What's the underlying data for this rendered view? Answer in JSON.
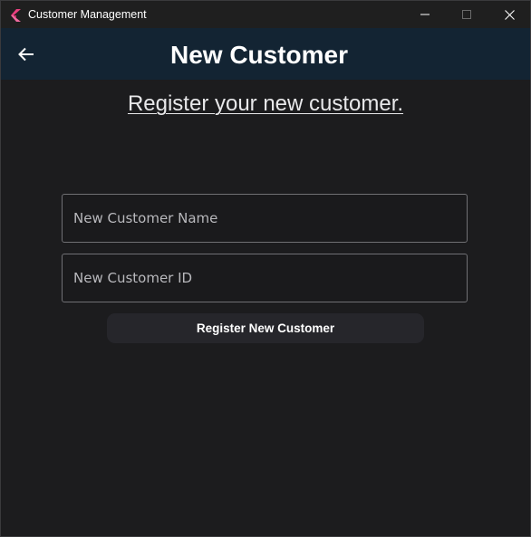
{
  "window": {
    "title": "Customer Management",
    "app_icon": "flutter-logo-icon",
    "controls": [
      "minimize-icon",
      "maximize-icon",
      "close-icon"
    ]
  },
  "appbar": {
    "back_icon": "arrow-back-icon",
    "title": "New Customer"
  },
  "main": {
    "subtitle": "Register your new customer.",
    "name_field": {
      "value": "",
      "placeholder": "New Customer Name"
    },
    "id_field": {
      "value": "",
      "placeholder": "New Customer ID"
    },
    "register_button_label": "Register New Customer"
  },
  "colors": {
    "background": "#1c1c1e",
    "appbar": "#132433",
    "titlebar": "#1f1f1f",
    "button": "#26262b",
    "field_border": "#707074"
  }
}
